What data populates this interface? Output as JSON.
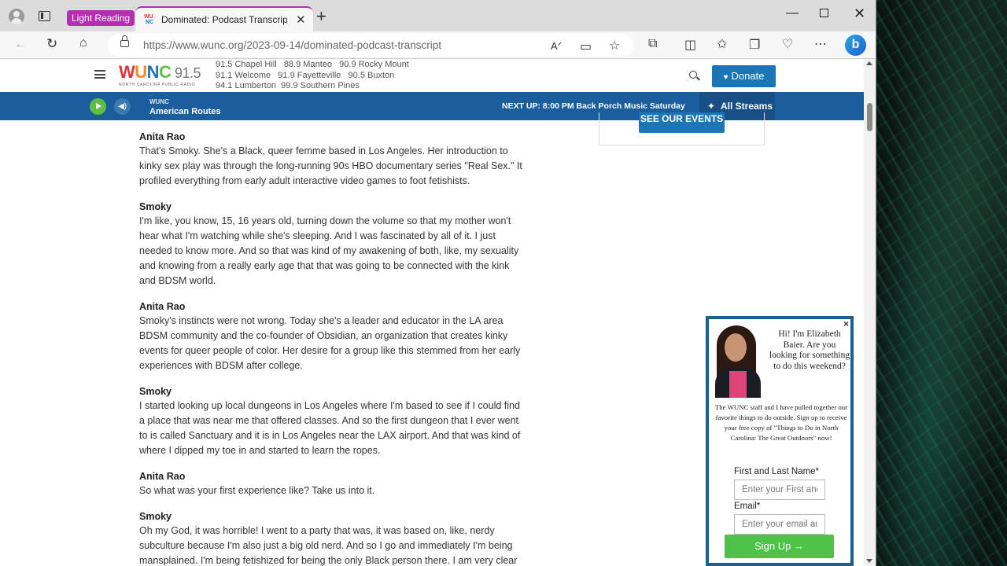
{
  "browser": {
    "tab_group_label": "Light Reading",
    "active_tab_title": "Dominated: Podcast Transcript | W",
    "tab_favicon_text": [
      "WU",
      "NC"
    ],
    "url_domain": "https://www.wunc.org",
    "url_path": "/2023-09-14/dominated-podcast-transcript",
    "bing_label": "b"
  },
  "site": {
    "logo_main": "WUNC 91.5",
    "logo_sub": "NORTH CAROLINA PUBLIC RADIO",
    "frequencies": [
      "91.5 Chapel Hill   88.9 Manteo   90.9 Rocky Mount",
      "91.1 Welcome   91.9 Fayetteville   90.5 Buxton",
      "94.1 Lumberton  99.9 Southern Pines"
    ],
    "donate_label": "Donate"
  },
  "player": {
    "station_small": "WUNC",
    "show": "American Routes",
    "next_up": "NEXT UP: 8:00 PM Back Porch Music Saturday",
    "all_streams": "All Streams"
  },
  "sidebar": {
    "events_button": "SEE OUR EVENTS"
  },
  "transcript": [
    {
      "speaker": "Anita Rao",
      "lines": [
        "That's Smoky. She's a Black, queer femme based in Los Angeles. Her introduction to",
        "kinky sex play was through the long-running 90s HBO documentary series \"Real Sex.\" It",
        "profiled everything from early adult interactive video games to foot fetishists."
      ]
    },
    {
      "speaker": "Smoky",
      "lines": [
        "I'm like, you know, 15, 16 years old, turning down the volume so that my mother won't",
        "hear what I'm watching while she's sleeping. And I was fascinated by all of it. I just",
        "needed to know more. And so that was kind of my awakening of both, like, my sexuality",
        "and knowing from a really early age that that was going to be connected with the kink",
        "and BDSM world."
      ]
    },
    {
      "speaker": "Anita Rao",
      "lines": [
        "Smoky's instincts were not wrong. Today she's a leader and educator in the LA area",
        "BDSM community and the co-founder of Obsidian, an organization that creates kinky",
        "events for queer people of color. Her desire for a group like this stemmed from her early",
        "experiences with BDSM after college."
      ]
    },
    {
      "speaker": "Smoky",
      "lines": [
        "I started looking up local dungeons in Los Angeles where I'm based to see if I could find",
        "a place that was near me that offered classes. And so the first dungeon that I ever went",
        "to is called Sanctuary and it is in Los Angeles near the LAX airport. And that was kind of",
        "where I dipped my toe in and started to learn the ropes."
      ]
    },
    {
      "speaker": "Anita Rao",
      "lines": [
        "So what was your first experience like? Take us into it."
      ]
    },
    {
      "speaker": "Smoky",
      "lines": [
        "Oh my God, it was horrible! I went to a party that was, it was based on, like, nerdy",
        "subculture because I'm also just a big old nerd. And so I go and immediately I'm being",
        "mansplained. I'm being fetishized for being the only Black person there. I am very clear"
      ]
    }
  ],
  "popup": {
    "close": "×",
    "greeting": "Hi! I'm Elizabeth Baier. Are you looking for something to do this weekend?",
    "body": "The WUNC staff and I have pulled together our favorite things to do outside. Sign up to receive your free copy of \"Things to Do in North Carolina: The Great Outdoors\" now!",
    "name_label": "First and Last Name*",
    "name_placeholder": "Enter your First and Last Name",
    "email_label": "Email*",
    "email_placeholder": "Enter your email address",
    "submit_label": "Sign Up →"
  },
  "colors": {
    "brand_blue": "#1b76b6",
    "player_blue": "#1b5e9d",
    "tab_group": "#b42eb4",
    "signup_green": "#4fc24a"
  }
}
